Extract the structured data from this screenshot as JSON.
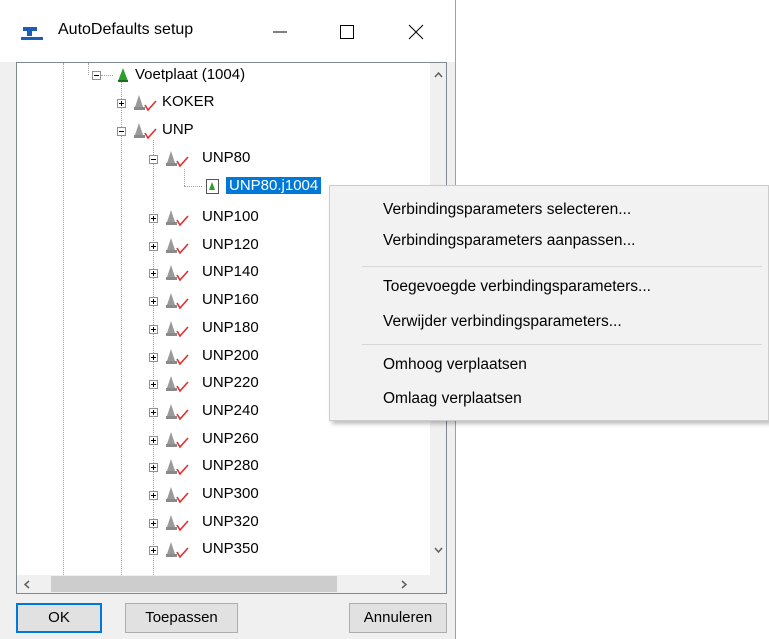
{
  "window": {
    "title": "AutoDefaults setup",
    "controls": [
      "minimize",
      "maximize",
      "close"
    ]
  },
  "tree": {
    "nodes": [
      {
        "label": "Voetplaat (1004)",
        "icon": "green-cone-icon",
        "expanded": true
      },
      {
        "label": "KOKER",
        "icon": "profile-check-icon",
        "expanded": false
      },
      {
        "label": "UNP",
        "icon": "profile-check-icon",
        "expanded": true
      },
      {
        "label": "UNP80",
        "icon": "profile-check-icon",
        "expanded": true
      },
      {
        "label": "UNP80.j1004",
        "icon": "parameter-file-icon",
        "selected": true
      },
      {
        "label": "UNP100",
        "icon": "profile-check-icon",
        "expanded": false
      },
      {
        "label": "UNP120",
        "icon": "profile-check-icon",
        "expanded": false
      },
      {
        "label": "UNP140",
        "icon": "profile-check-icon",
        "expanded": false
      },
      {
        "label": "UNP160",
        "icon": "profile-check-icon",
        "expanded": false
      },
      {
        "label": "UNP180",
        "icon": "profile-check-icon",
        "expanded": false
      },
      {
        "label": "UNP200",
        "icon": "profile-check-icon",
        "expanded": false
      },
      {
        "label": "UNP220",
        "icon": "profile-check-icon",
        "expanded": false
      },
      {
        "label": "UNP240",
        "icon": "profile-check-icon",
        "expanded": false
      },
      {
        "label": "UNP260",
        "icon": "profile-check-icon",
        "expanded": false
      },
      {
        "label": "UNP280",
        "icon": "profile-check-icon",
        "expanded": false
      },
      {
        "label": "UNP300",
        "icon": "profile-check-icon",
        "expanded": false
      },
      {
        "label": "UNP320",
        "icon": "profile-check-icon",
        "expanded": false
      },
      {
        "label": "UNP350",
        "icon": "profile-check-icon",
        "expanded": false
      }
    ]
  },
  "buttons": {
    "ok": "OK",
    "apply": "Toepassen",
    "cancel": "Annuleren"
  },
  "context_menu": {
    "items": [
      "Verbindingsparameters selecteren...",
      "Verbindingsparameters aanpassen...",
      "Toegevoegde verbindingsparameters...",
      "Verwijder verbindingsparameters...",
      "Omhoog verplaatsen",
      "Omlaag verplaatsen"
    ]
  },
  "colors": {
    "selection": "#0078d7",
    "cone_green": "#2e9e2e",
    "check_red": "#e03030"
  }
}
